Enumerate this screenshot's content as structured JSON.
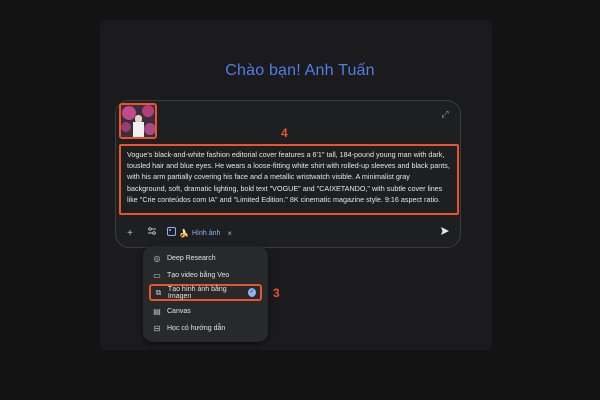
{
  "greeting": "Chào bạn! Anh Tuấn",
  "prompt": {
    "text": "Vogue's black-and-white fashion editorial cover features a 6'1\" tall, 184-pound young man with dark, tousled hair and blue eyes. He wears a loose-fitting white shirt with rolled-up sleeves and black pants, with his arm partially covering his face and a metallic wristwatch visible. A minimalist gray background, soft, dramatic lighting, bold text \"VOGUE\" and \"CAIXETANDO,\" with subtle cover lines like \"Crie conteúdos com IA\" and \"Limited Edition.\" 8K cinematic magazine style. 9:16 aspect ratio."
  },
  "annotations": {
    "step4": "4",
    "step3": "3"
  },
  "toolbar": {
    "add_icon": "plus-icon",
    "tools_icon": "tools-icon",
    "chip_label": "Hình ảnh",
    "chip_close": "×"
  },
  "menu": {
    "items": [
      {
        "label": "Deep Research",
        "icon": "deep-research-icon"
      },
      {
        "label": "Tạo video bằng Veo",
        "icon": "video-icon"
      },
      {
        "label": "Tạo hình ảnh bằng Imagen",
        "icon": "image-gen-icon",
        "selected": true
      },
      {
        "label": "Canvas",
        "icon": "canvas-icon"
      },
      {
        "label": "Học có hướng dẫn",
        "icon": "guided-learning-icon"
      }
    ]
  },
  "colors": {
    "accent": "#4f7fe8",
    "highlight": "#e8542e",
    "chip": "#8ab4f8"
  }
}
